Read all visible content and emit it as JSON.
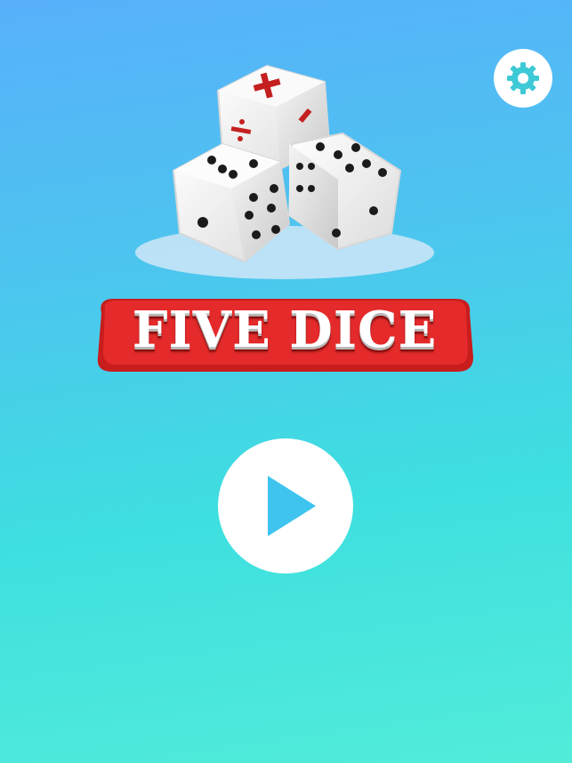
{
  "title": "FIVE DICE",
  "icons": {
    "settings": "gear-icon",
    "play": "play-icon",
    "logo": "dice-icon"
  },
  "colors": {
    "background_top": "#58b0fb",
    "background_bottom": "#52ecd9",
    "title_red": "#e12626",
    "title_text": "#ffffff",
    "button_white": "#ffffff",
    "play_icon": "#3ec4ee",
    "gear_icon": "#3ec9d6",
    "operator_red": "#c42020"
  }
}
